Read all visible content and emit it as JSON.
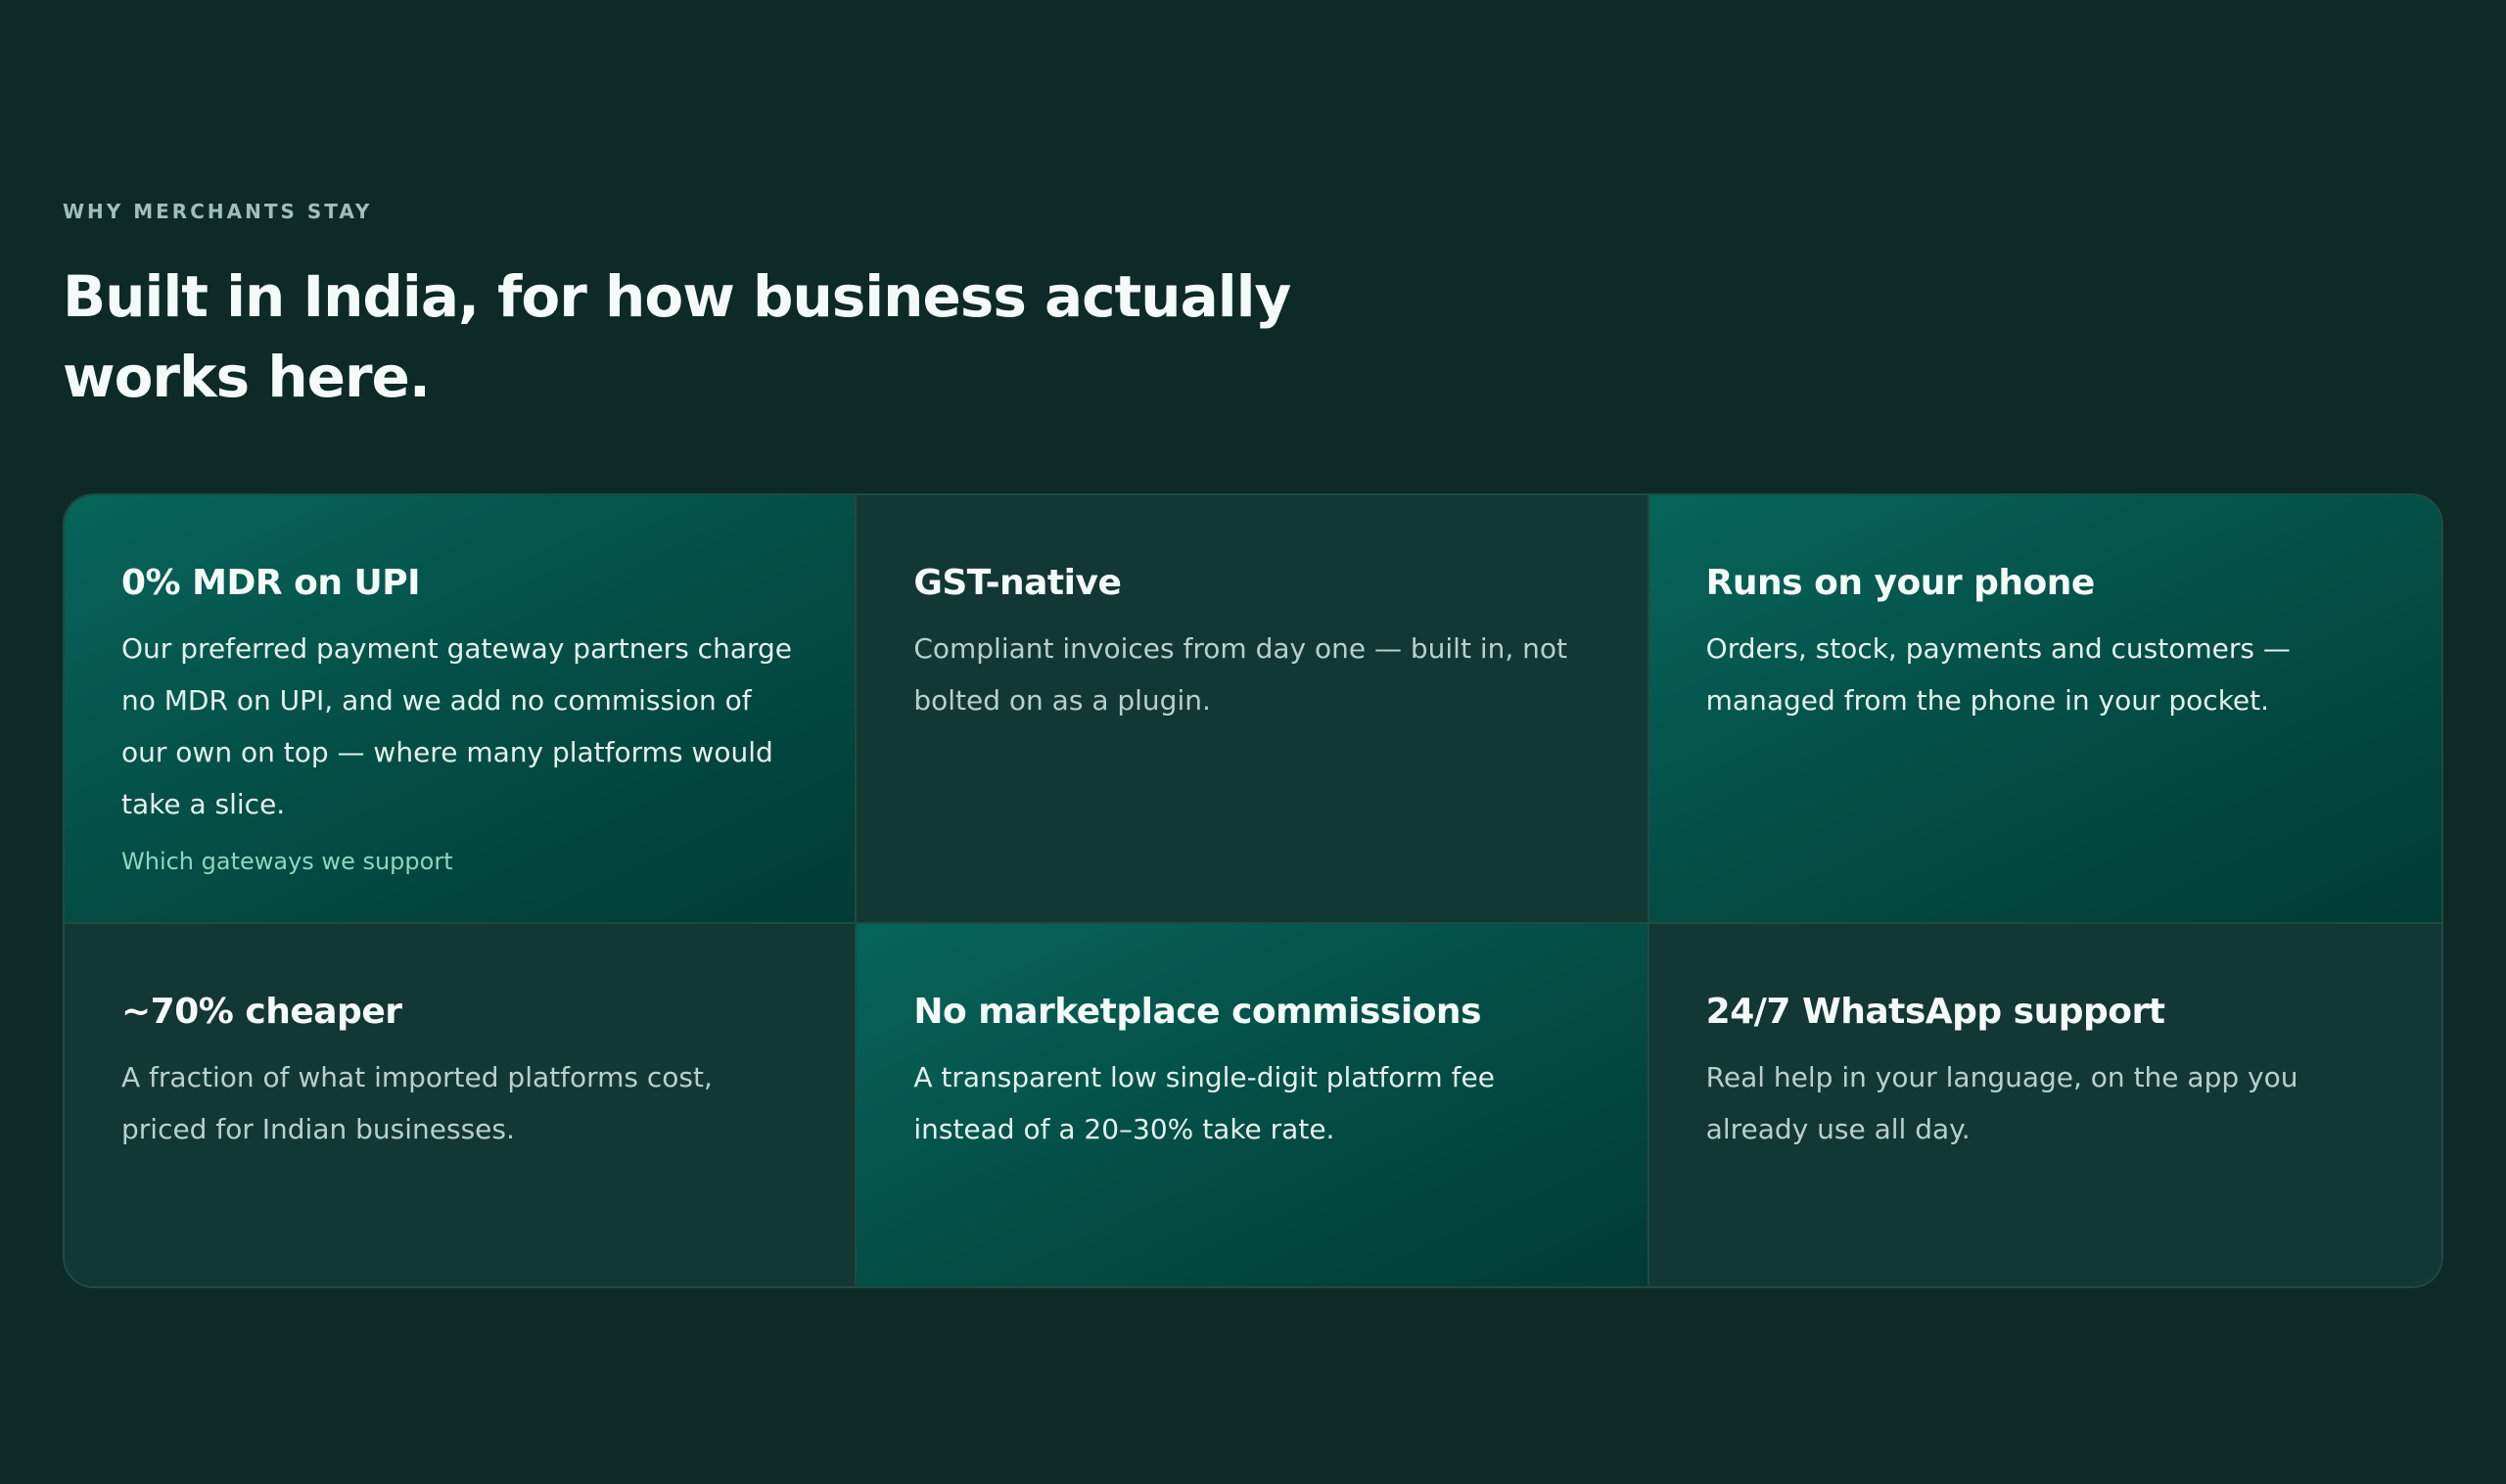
{
  "section": {
    "eyebrow": "WHY MERCHANTS STAY",
    "headline": "Built in India, for how business actually works here."
  },
  "cards": [
    {
      "title": "0% MDR on UPI",
      "body": "Our preferred payment gateway partners charge no MDR on UPI, and we add no commission of our own on top — where many platforms would take a slice.",
      "link": "Which gateways we support",
      "accent": true
    },
    {
      "title": "GST-native",
      "body": "Compliant invoices from day one — built in, not bolted on as a plugin.",
      "accent": false
    },
    {
      "title": "Runs on your phone",
      "body": "Orders, stock, payments and customers — managed from the phone in your pocket.",
      "accent": true
    },
    {
      "title": "~70% cheaper",
      "body": "A fraction of what imported platforms cost, priced for Indian businesses.",
      "accent": false
    },
    {
      "title": "No marketplace commissions",
      "body": "A transparent low single-digit platform fee instead of a 20–30% take rate.",
      "accent": true
    },
    {
      "title": "24/7 WhatsApp support",
      "body": "Real help in your language, on the app you already use all day.",
      "accent": false
    }
  ],
  "colors": {
    "page_background": "#0d2a26",
    "card_background": "#133733",
    "accent_gradient_start": "#07655a",
    "accent_gradient_end": "#023b35",
    "link": "#8fd6c2"
  }
}
